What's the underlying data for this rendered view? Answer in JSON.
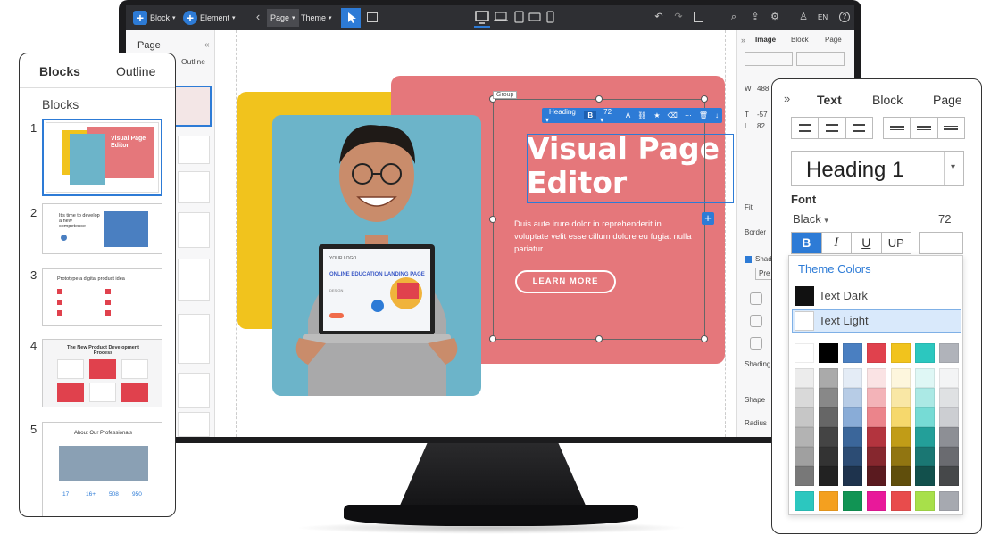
{
  "toolbar": {
    "block_label": "Block",
    "element_label": "Element",
    "page_label": "Page",
    "theme_label": "Theme",
    "lang": "EN"
  },
  "page_panel": {
    "title": "Page",
    "tab_outline": "Outline"
  },
  "right_panel": {
    "tabs": [
      "Image",
      "Block",
      "Page"
    ],
    "field_w": "W",
    "field_w_val": "488",
    "field_t": "T",
    "field_t_val": "-57",
    "field_l": "L",
    "field_l_val": "82",
    "fit_label": "Fit",
    "border_label": "Border",
    "shadow_label": "Shad",
    "shadow_btn": "Pre",
    "shading_label": "Shading",
    "shape_label": "Shape",
    "radius_label": "Radius"
  },
  "hero": {
    "title_line1": "Visual Page",
    "title_line2": "Editor",
    "body": "Duis aute irure dolor in reprehenderit in voluptate velit esse cillum dolore eu fugiat nulla pariatur.",
    "button": "LEARN MORE",
    "group_tag": "Group",
    "laptop_logo": "YOUR LOGO",
    "laptop_heading": "ONLINE EDUCATION LANDING PAGE",
    "laptop_sub": "DESIGN"
  },
  "inline_toolbar": {
    "style": "Heading",
    "bold": "B",
    "size": "72"
  },
  "blocks_panel": {
    "tab_blocks": "Blocks",
    "tab_outline": "Outline",
    "heading": "Blocks",
    "items": [
      {
        "num": "1",
        "title": "Visual Page Editor"
      },
      {
        "num": "2",
        "title": "It's time to develop a new competence"
      },
      {
        "num": "3",
        "title": "Prototype a digital product idea"
      },
      {
        "num": "4",
        "title": "The New Product Development Process"
      },
      {
        "num": "5",
        "title": "About Our Professionals",
        "stats": [
          "17",
          "16+",
          "508",
          "950"
        ]
      }
    ]
  },
  "text_panel": {
    "tabs": [
      "Text",
      "Block",
      "Page"
    ],
    "heading_select": "Heading 1",
    "font_label": "Font",
    "font_weight": "Black",
    "font_size": "72",
    "style_buttons": [
      "B",
      "I",
      "U",
      "UP"
    ],
    "theme_colors_label": "Theme Colors",
    "theme_colors": [
      {
        "label": "Text Dark",
        "color": "#111111"
      },
      {
        "label": "Text Light",
        "color": "#ffffff"
      }
    ],
    "palette_top": [
      "#ffffff",
      "#000000",
      "#4a7fc1",
      "#e0414d",
      "#f1c31d",
      "#2cc7bf",
      "#b0b3ba"
    ],
    "palette_bottom": [
      "#2cc7bf",
      "#f4a01f",
      "#119454",
      "#e8199a",
      "#e84c4c",
      "#a8e04a",
      "#a6a9b0"
    ],
    "accent": "#2d7bd6"
  }
}
